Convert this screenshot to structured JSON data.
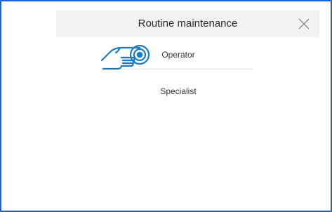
{
  "dialog": {
    "title": "Routine maintenance"
  },
  "menu": {
    "items": [
      {
        "label": "Operator"
      },
      {
        "label": "Specialist"
      }
    ]
  },
  "icons": {
    "close": "close-icon",
    "hint": "hand-tap-icon"
  },
  "colors": {
    "frame_border": "#1f62d6",
    "header_bg": "#f1f2f3",
    "icon_blue": "#1a7cc4"
  }
}
